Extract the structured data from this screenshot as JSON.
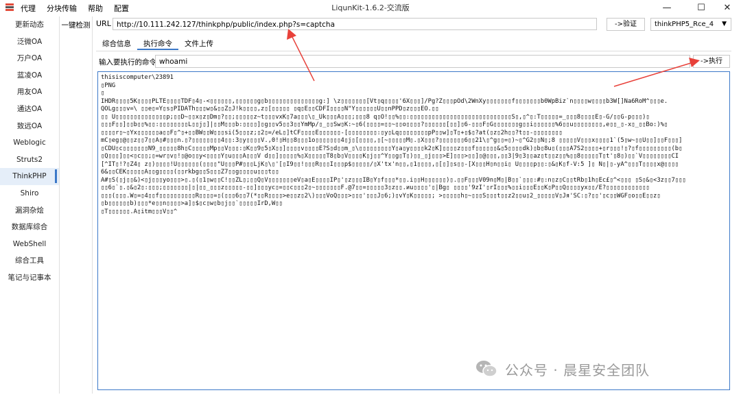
{
  "window": {
    "title": "LiqunKit-1.6.2-交流版",
    "controls": {
      "minimize": "—",
      "maximize": "☐",
      "close": "✕"
    }
  },
  "menu": [
    "代理",
    "分块传输",
    "帮助",
    "配置"
  ],
  "sidebar": {
    "items": [
      "更新动态",
      "泛微OA",
      "万户OA",
      "蓝凌OA",
      "用友OA",
      "通达OA",
      "致远OA",
      "Weblogic",
      "Struts2",
      "ThinkPHP",
      "Shiro",
      "漏洞杂烩",
      "数据库综合",
      "WebShell",
      "综合工具",
      "笔记与记事本"
    ],
    "active": "ThinkPHP"
  },
  "sub_sidebar": {
    "items": [
      "一键检测"
    ]
  },
  "url_bar": {
    "label": "URL",
    "value": "http://10.111.242.127/thinkphp/public/index.php?s=captcha",
    "verify_label": "->验证",
    "selected_option": "thinkPHP5_Rce_4"
  },
  "tabs": [
    {
      "label": "综合信息",
      "active": false
    },
    {
      "label": "执行命令",
      "active": true
    },
    {
      "label": "文件上传",
      "active": false
    }
  ],
  "command": {
    "label": "输入要执行的命令:",
    "value": "whoami",
    "execute_label": "->执行"
  },
  "output": {
    "lines": [
      "thisiscomputer\\23891",
      "▯PNG",
      "▯",
      "IHDR▯▯▯▯5K▯▯▯▯PLTE▯▯▯▯TDF▯4▯-<▯▯▯▯▯▯,▯▯▯▯▯▯g▯b▯▯▯▯▯▯▯▯▯▯▯▯▯▯g:] \\z▯▯▯▯▯▯▯[Vt▯q▯▯▯▯'6X▯▯▯]/Pg?Z▯▯▯pOd\\2WnXy▯▯▯▯▯▯▯f▯▯▯▯▯▯▯b0WpBiz`n▯▯▯▯w▯▯▯▯b3W[]Na6RoM^▯▯▯e.",
      "QOLg▯▯▯v=\\ ▯▯e▯=Y▯s▯PIDATh▯▯▯w▯&▯▯Z▯J!k▯▯▯▯,z▯[▯▯▯▯▯ ▯q▯E▯▯CDFI▯▯▯▯N\"Y▯▯▯▯▯▯U▯▯nPPD▯z▯▯▯EO.▯▯",
      "▯▯        U▯▯▯▯▯▯▯▯▯▯▯▯▯▯p;▯▯D~▯▯x▯z▯Dm▯?▯▯;▯▯▯▯▯z~t▯▯▯vxK▯7a▯▯▯\\▯_Uk▯▯▯A▯▯▯;▯▯▯8 q▯O!▯▯%▯▯:▯▯▯▯▯▯▯▯▯▯▯▯▯▯▯▯▯▯▯▯▯▯▯▯▯▯▯▯S▯,▯^▯:T▯▯▯▯▯=_▯▯▯8▯▯▯▯E▯-G/▯▯G-p▯▯▯)▯",
      "▯▯▯F▯▯]▯▯b▯▯%▯▯:▯▯▯▯▯▯▯▯L▯▯j▯]|▯▯M▯▯▯b:▯▯▯▯]▯g▯▯v5▯▯3▯▯YmMp/▯_▯▯Sw▯K:~▯6(▯▯▯▯=▯▯~▯▯o▯▯▯▯?▯▯▯▯▯▯[▯▯]▯6-▯▯▯F▯G▯▯▯▯▯▯▯g▯▯i▯▯▯▯▯▯%6▯▯u▯▯▯▯▯▯▯▯,e▯▯_▯-x▯_▯▯Bo:)%▯",
      "▯▯▯▯r▯~▯Yx▯▯▯▯▯▯a▯▯F▯^▯+▯▯BW▯▯W▯▯▯si(5▯▯▯z;▯2▯=/eL▯]tCF▯▯▯▯E▯▯▯▯▯▯-[▯▯▯▯▯▯▯▯:▯y▯Lq▯▯▯▯▯▯▯▯pP▯▯w]▯T▯+▯$▯?at(▯z▯2h▯▯?t▯▯-▯▯▯▯▯▯▯▯",
      "mC▯eg▯@▯▯z▯▯7▯▯A▯#▯▯▯n.▯?▯▯▯▯▯▯▯▯4▯▯:3▯y▯▯▯▯V.,0!▯H▯▯8▯▯▯1o▯▯▯▯▯▯▯4▯j▯[▯▯▯▯,▯[~▯▯▯▯▯M▯.▯X▯▯▯?▯▯▯▯▯▯▯6▯▯21\\▯^g▯▯=▯)~▯^G2▯▯N▯;8 ▯▯▯▯▯V▯▯▯x▯▯▯▯1`(5▯w~▯▯U▯▯]▯▯F▯▯▯]",
      "▯CDU▯c▯▯▯▯▯▯▯N9_▯▯▯▯▯8h▯C▯▯▯▯▯Mp▯▯V▯▯▯:▯K▯▯9▯5▯X▯▯]▯▯▯▯v▯▯▯▯E?S▯d▯▯m_▯\\▯▯▯▯▯▯▯▯▯Y▯a▯y▯▯▯▯k2▯K]▯▯▯▯z▯▯▯f▯▯▯▯▯▯&▯5▯▯▯▯dk)▯b▯8u▯(▯▯▯A7S2▯▯▯▯+▯r▯▯▯!▯?▯f▯▯▯▯▯▯▯▯▯(b▯",
      "▯Q▯▯▯]▯▯<▯c▯▯;▯=wr▯v▯!▯@o▯▯y<▯▯▯▯Y▯u▯▯▯A▯▯▯V d▯▯]▯▯▯▯▯%▯X▯▯▯▯▯T8▯b▯V▯▯▯▯K▯j▯▯^Y▯▯g▯T▯)▯▯_▯j▯▯▯>E]▯▯▯>▯▯]▯@▯▯▯,▯▯3|9▯3▯▯az▯t▯▯z▯▯%▯▯8▯▯▯▯▯T▯t'▯8▯)▯▯`V▯▯▯▯▯▯▯▯CI",
      "[^IT▯!?▯Z4▯ z▯)▯▯▯▯!U▯▯▯▯▯▯(▯▯▯▯\"U▯▯▯P#▯▯▯LjK▯\\▯'[▯I9▯▯!▯▯▯R▯▯▯I▯▯▯p$▯▯▯▯▯/▯X'tx'n▯▯,▯1▯▯▯▯,▯[▯]▯s▯▯-[X▯▯▯H▯n▯▯i▯        U▯▯▯▯p▯▯:▯&▯K▯f-V:5 ]▯          N▯|▯-yA^▯▯▯T▯▯▯▯x@▯▯▯▯",
      "6&▯▯CEK▯▯▯▯▯A▯▯g▯▯▯▯(▯▯rkbg▯▯S▯▯▯Z7▯▯g▯▯▯▯u▯▯▯t▯▯",
      "A#▯S(▯j▯▯&)<▯j▯▯▯yo▯▯▯>▯.▯(▯1▯w▯▯C!▯▯ZL▯;▯▯Q▯V▯▯▯▯▯▯▯eV▯a▯E▯▯▯▯IP▯'▯z▯▯▯IB▯Y▯f▯▯▯*▯▯.i▯▯H▯▯▯▯▯▯)▯.▯▯F▯▯▯V09n▯M▯|B▯▯`▯▯▯:#▯:n▯z▯C▯▯tRb▯1h▯Ec£▯^<▯▯▯ ▯S▯&▯<3z▯▯7▯▯▯",
      "▯▯6▯`▯.▯&▯2▯:▯▯▯;▯▯▯▯▯▯▯|▯|▯▯_▯▯▯z▯▯▯▯▯-▯▯]▯▯▯yc▯=▯▯c▯▯▯2▯~▯▯▯▯▯▯▯F.@7▯▯=▯▯▯▯▯3▯z▯▯.иu▯▯▯▯'▯|Bg▯ ▯▯▯▯'9zI'▯rI▯▯▯%▯▯i▯▯▯E▯▯K▯P▯▯Q▯▯▯▯yx▯▯/E?▯▯▯▯▯▯▯▯▯▯▯▯",
      "▯▯▯(▯▯▯.W▯=▯4▯▯f▯▯▯▯▯▯▯▯▯▯R▯▯▯▯=▯(▯▯▯6▯▯7(*▯▯R▯▯▯▯>e▯▯z▯2\\)▯▯▯VoQ▯▯▯>▯▯▯'▯▯▯J▯6;)▯vY▯K▯▯▯▯▯;          >▯▯▯▯▯h▯~▯▯▯S▯▯▯t▯▯z2▯▯u▯2_▯▯▯▯▯V▯Jя'SC:▯?▯▯'▯c▯▯WĜF▯o▯▯E▯▯z▯",
      "▯b▯▯▯▯▯▯b)▯▯▯*e▯▯n▯▯▯▯>a]▯$▯c▯w▯b▯j▯▯`▯▯▯▯▯IrD,W▯▯",
      "▯T▯▯▯▯▯▯.A▯itm▯▯▯V▯▯^"
    ]
  },
  "watermark": {
    "text": "公众号 · 晨星安全团队",
    "icon": "wechat-icon"
  },
  "colors": {
    "accent": "#3b78c8",
    "arrow": "#e8413a",
    "titlebar": "#ffffff"
  }
}
